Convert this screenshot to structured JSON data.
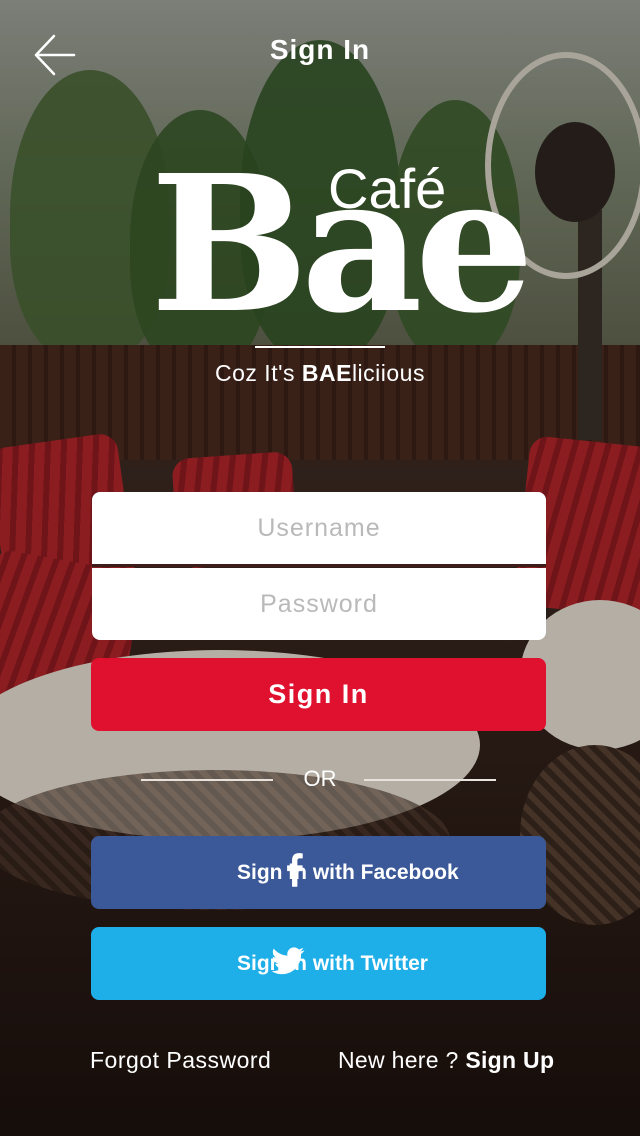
{
  "header": {
    "title": "Sign In"
  },
  "logo": {
    "brand": "Bae",
    "cafe": "Café"
  },
  "tagline": {
    "prefix": "Coz It's ",
    "bold": "BAE",
    "suffix": "liciious"
  },
  "form": {
    "username_placeholder": "Username",
    "password_placeholder": "Password",
    "signin_label": "Sign In",
    "or_label": "OR"
  },
  "social": {
    "facebook_label": "Sign in with Facebook",
    "twitter_label": "Sign in with Twitter"
  },
  "footer": {
    "forgot_label": "Forgot Password",
    "new_here_label": "New here ? ",
    "signup_label": "Sign Up"
  },
  "colors": {
    "signin_button": "#e0102f",
    "facebook_button": "#3b5998",
    "twitter_button": "#1eaee8"
  },
  "icons": {
    "back": "arrow-left-icon",
    "facebook": "facebook-icon",
    "twitter": "twitter-icon"
  }
}
